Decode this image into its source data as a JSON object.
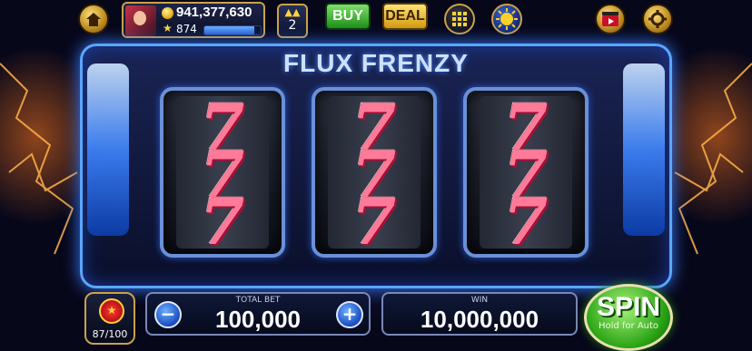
{
  "game": {
    "title": "FLUX FRENZY"
  },
  "player": {
    "balance": "941,377,630",
    "level": "874",
    "xp_progress": 0.88
  },
  "topbar": {
    "levelup_count": "2",
    "buy_label": "BUY",
    "deal_label": "DEAL"
  },
  "reels": [
    {
      "symbols": [
        "7",
        "7",
        "7"
      ]
    },
    {
      "symbols": [
        "7",
        "7",
        "7"
      ]
    },
    {
      "symbols": [
        "7",
        "7",
        "7"
      ]
    }
  ],
  "bet": {
    "label": "TOTAL BET",
    "value": "100,000",
    "minus": "−",
    "plus": "+"
  },
  "win": {
    "label": "WIN",
    "value": "10,000,000"
  },
  "spin": {
    "label": "SPIN",
    "sublabel": "Hold for Auto"
  },
  "bonus": {
    "count": "87/100"
  },
  "icons": {
    "home": "home-icon",
    "coin": "coin-icon",
    "star": "star-icon",
    "levelup": "level-up-icon",
    "menu": "grid-menu-icon",
    "sun": "sun-icon",
    "video": "video-reward-icon",
    "settings": "gear-icon",
    "bonus": "bonus-gift-icon"
  },
  "colors": {
    "accent": "#5aa6ff",
    "spin": "#2aa414",
    "gold": "#c9a24a",
    "buy": "#1f8e18",
    "deal": "#d59a10"
  }
}
